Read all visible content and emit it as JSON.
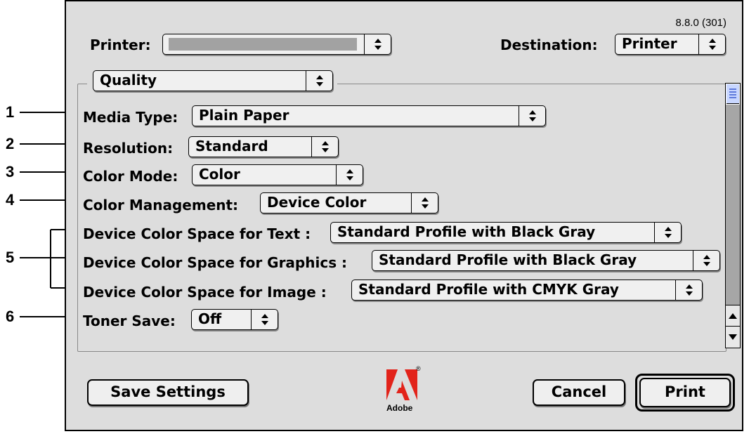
{
  "version": "8.8.0 (301)",
  "printer": {
    "label": "Printer:",
    "value": ""
  },
  "destination": {
    "label": "Destination:",
    "value": "Printer"
  },
  "panel_select": {
    "value": "Quality"
  },
  "settings": [
    {
      "label": "Media Type:",
      "value": "Plain Paper"
    },
    {
      "label": "Resolution:",
      "value": "Standard"
    },
    {
      "label": "Color Mode:",
      "value": "Color"
    },
    {
      "label": "Color Management:",
      "value": "Device Color"
    },
    {
      "label": "Device Color Space for Text :",
      "value": "Standard Profile with Black Gray"
    },
    {
      "label": "Device Color Space for Graphics :",
      "value": "Standard Profile with Black Gray"
    },
    {
      "label": "Device Color Space for Image :",
      "value": "Standard Profile with CMYK Gray"
    },
    {
      "label": "Toner Save:",
      "value": "Off"
    }
  ],
  "callouts": [
    "1",
    "2",
    "3",
    "4",
    "5",
    "6"
  ],
  "buttons": {
    "save": "Save Settings",
    "cancel": "Cancel",
    "print": "Print"
  },
  "logo": {
    "text": "Adobe",
    "color": "#e2231a",
    "icon": "adobe-logo-icon"
  },
  "colors": {
    "dialog_bg": "#dddddd",
    "scroll_thumb": "#c9d7ff",
    "scroll_track": "#a6a6a6"
  }
}
